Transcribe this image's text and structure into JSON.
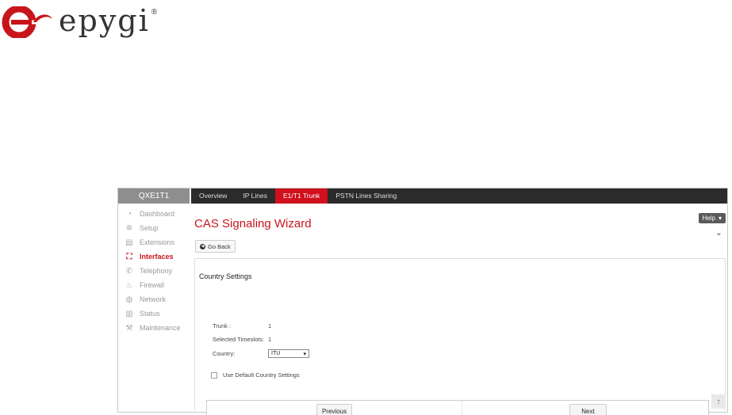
{
  "brand": {
    "name": "epygi",
    "reg": "®",
    "accent": "#c8151b"
  },
  "sidebar": {
    "title": "QXE1T1",
    "items": [
      {
        "label": "Dashboard",
        "icon": "dashboard-icon"
      },
      {
        "label": "Setup",
        "icon": "gear-icon"
      },
      {
        "label": "Extensions",
        "icon": "book-icon"
      },
      {
        "label": "Interfaces",
        "icon": "network-tree-icon",
        "active": true
      },
      {
        "label": "Telephony",
        "icon": "phone-icon"
      },
      {
        "label": "Firewall",
        "icon": "flame-icon"
      },
      {
        "label": "Network",
        "icon": "globe-icon"
      },
      {
        "label": "Status",
        "icon": "bar-chart-icon"
      },
      {
        "label": "Maintenance",
        "icon": "wrench-icon"
      }
    ]
  },
  "tabs": [
    {
      "label": "Overview"
    },
    {
      "label": "IP Lines"
    },
    {
      "label": "E1/T1 Trunk",
      "active": true
    },
    {
      "label": "PSTN Lines Sharing"
    }
  ],
  "header": {
    "title": "CAS Signaling Wizard",
    "help_label": "Help",
    "go_back_label": "Go Back"
  },
  "form": {
    "section_title": "Country Settings",
    "trunk_label": "Trunk :",
    "trunk_value": "1",
    "timeslots_label": "Selected Timeslots:",
    "timeslots_value": "1",
    "country_label": "Country:",
    "country_value": "ITU",
    "default_checkbox_label": "Use Default Country Settings"
  },
  "buttons": {
    "previous": "Previous",
    "next": "Next"
  }
}
